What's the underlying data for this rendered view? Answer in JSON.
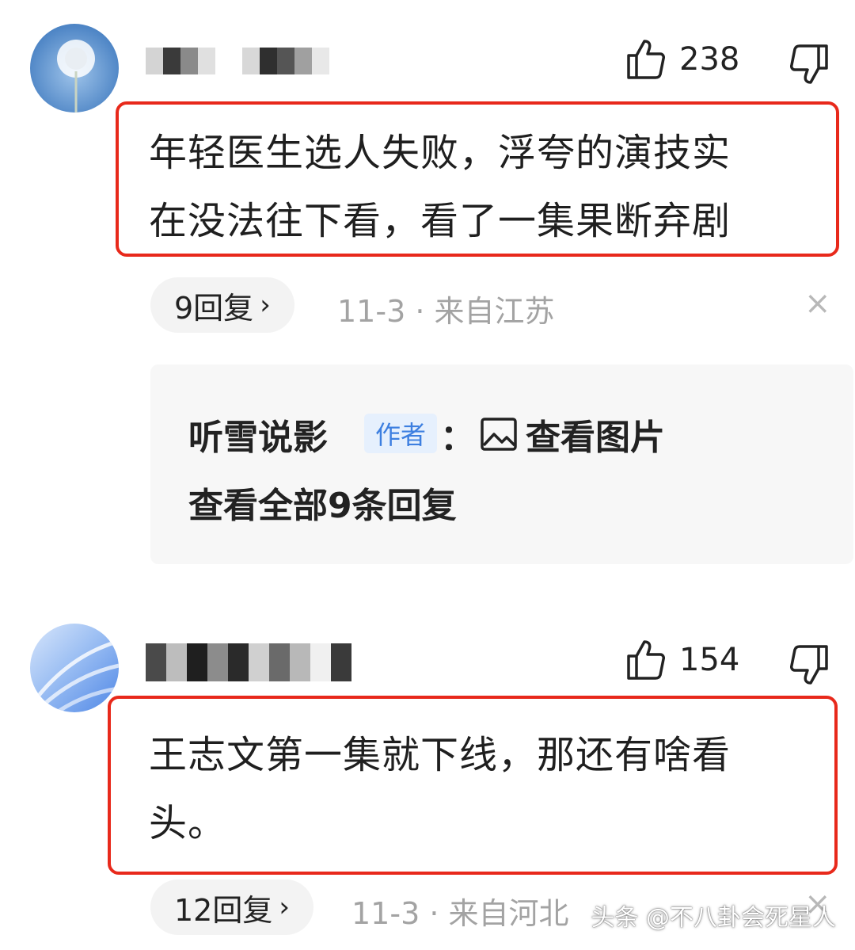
{
  "comments": [
    {
      "likes": "238",
      "text_lines": [
        "年轻医生选人失败，浮夸的演技实",
        "在没法往下看，看了一集果断弃剧"
      ],
      "reply_count_label": "9回复",
      "meta": "11-3 · 来自江苏",
      "sub_reply": {
        "author": "听雪说影",
        "badge": "作者",
        "colon": "：",
        "content": "查看图片",
        "view_all": "查看全部9条回复"
      }
    },
    {
      "likes": "154",
      "text_lines": [
        "王志文第一集就下线，那还有啥看",
        "头。"
      ],
      "reply_count_label": "12回复",
      "meta": "11-3 · 来自河北"
    }
  ],
  "icons": {
    "like": "thumbs-up-icon",
    "dislike": "thumbs-down-icon",
    "close": "close-icon",
    "chevron": "chevron-right-icon",
    "image": "image-icon"
  },
  "colors": {
    "highlight": "#e8291b",
    "badge_text": "#3d7fe0",
    "badge_bg": "#e6f0fd",
    "meta_text": "#a3a3a3"
  },
  "chevron_glyph": "›",
  "close_glyph": "×",
  "watermark": "头条 @不八卦会死星人"
}
